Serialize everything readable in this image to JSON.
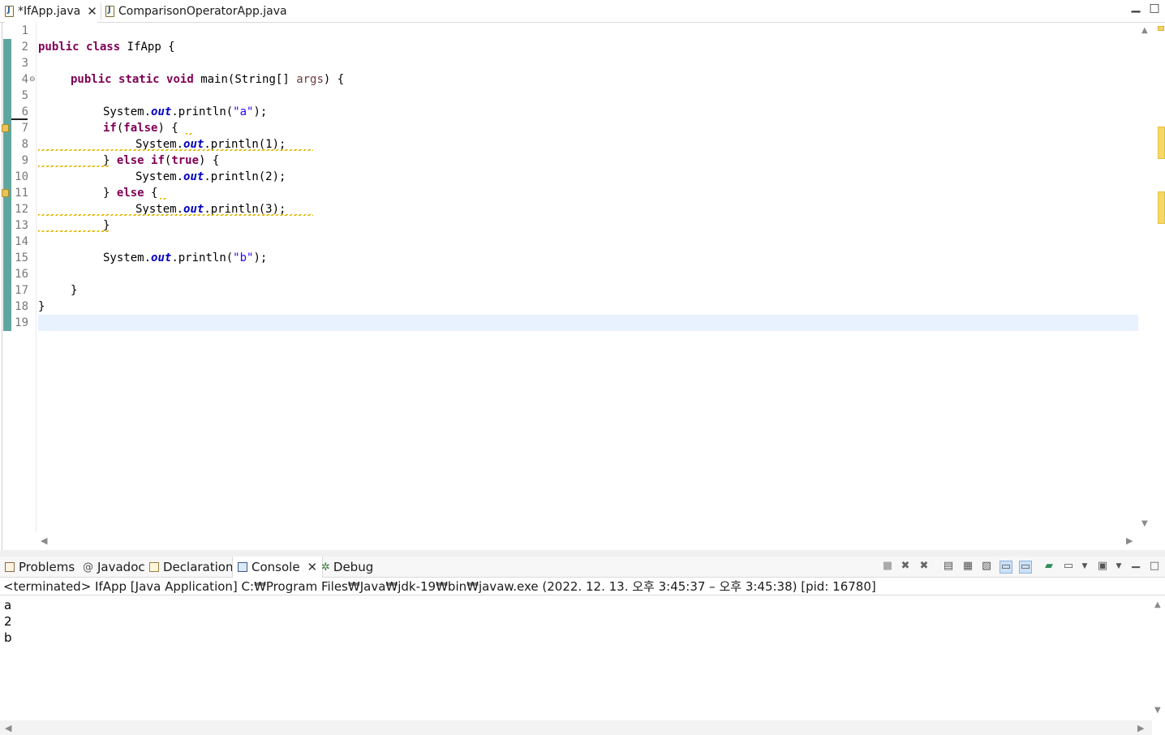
{
  "editor_tabs": [
    {
      "label": "*IfApp.java",
      "active": true,
      "closable": true
    },
    {
      "label": "ComparisonOperatorApp.java",
      "active": false
    }
  ],
  "window_controls": {
    "minimize": "▭",
    "maximize": "□"
  },
  "line_numbers": [
    "1",
    "2",
    "3",
    "4",
    "5",
    "6",
    "7",
    "8",
    "9",
    "10",
    "11",
    "12",
    "13",
    "14",
    "15",
    "16",
    "17",
    "18",
    "19"
  ],
  "code": {
    "l2_kw1": "public",
    "l2_kw2": "class",
    "l2_name": "IfApp {",
    "l4_kw1": "public",
    "l4_kw2": "static",
    "l4_kw3": "void",
    "l4_mid": "main(String[] ",
    "l4_param": "args",
    "l4_end": ") {",
    "l6_a": "System.",
    "l6_fld": "out",
    "l6_b": ".println(",
    "l6_str": "\"a\"",
    "l6_c": ");",
    "l7_kw": "if",
    "l7_a": "(",
    "l7_kw2": "false",
    "l7_b": ") {",
    "l8_a": "System.",
    "l8_fld": "out",
    "l8_b": ".println(1);",
    "l9_a": "} ",
    "l9_kw1": "else",
    "l9_sp": " ",
    "l9_kw2": "if",
    "l9_b": "(",
    "l9_kw3": "true",
    "l9_c": ") {",
    "l10_a": "System.",
    "l10_fld": "out",
    "l10_b": ".println(2);",
    "l11_a": "} ",
    "l11_kw": "else",
    "l11_b": " {",
    "l12_a": "System.",
    "l12_fld": "out",
    "l12_b": ".println(3);",
    "l13": "}",
    "l15_a": "System.",
    "l15_fld": "out",
    "l15_b": ".println(",
    "l15_str": "\"b\"",
    "l15_c": ");",
    "l17": "}",
    "l18": "}"
  },
  "panel_tabs": [
    {
      "label": "Problems"
    },
    {
      "label": "Javadoc"
    },
    {
      "label": "Declaration"
    },
    {
      "label": "Console",
      "active": true
    },
    {
      "label": "Debug"
    }
  ],
  "console": {
    "status": "<terminated> IfApp [Java Application] C:₩Program Files₩Java₩jdk-19₩bin₩javaw.exe  (2022. 12. 13. 오후 3:45:37 – 오후 3:45:38) [pid: 16780]",
    "output": [
      "a",
      "2",
      "b"
    ]
  },
  "colors": {
    "keyword": "#7f0055",
    "field": "#0000c0",
    "string": "#2a00ff",
    "param": "#6a3e3e",
    "current_line": "#e8f2fe",
    "quickdiff": "#5fa79e"
  }
}
